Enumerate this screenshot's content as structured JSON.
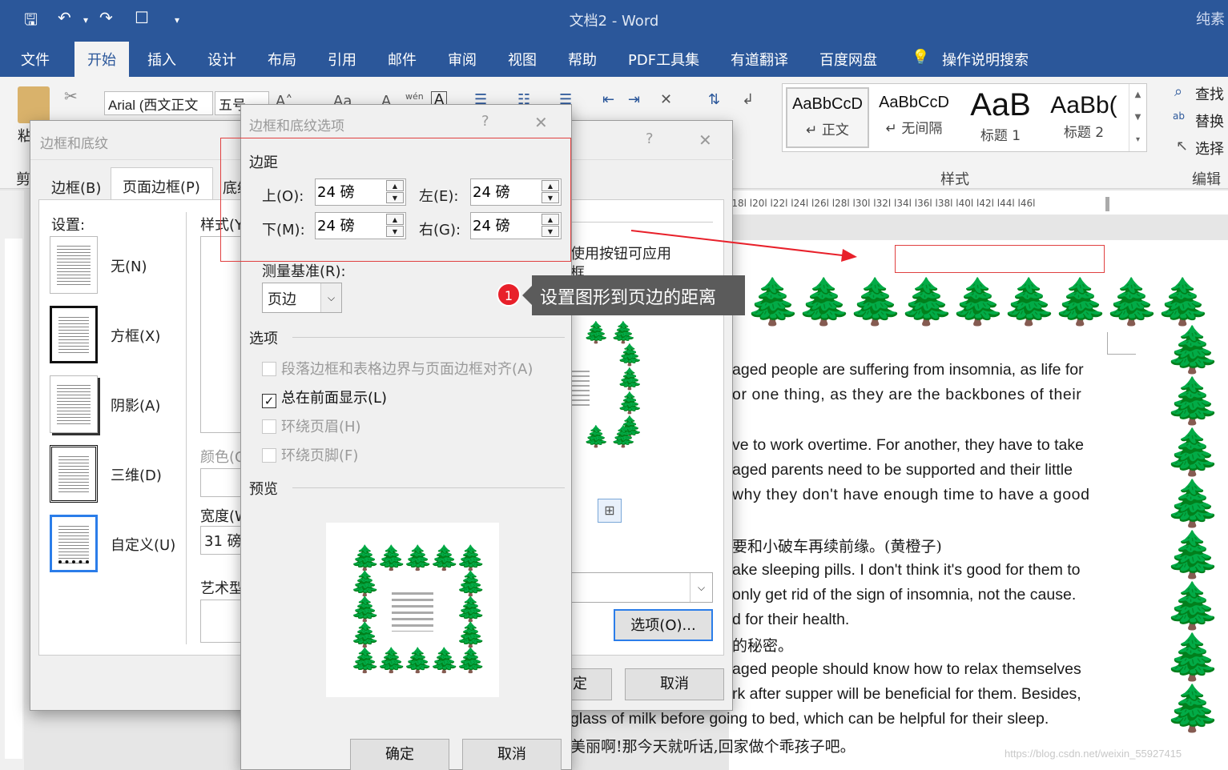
{
  "window": {
    "title": "文档2  -  Word",
    "right_note": "纯素"
  },
  "tabs": [
    "文件",
    "开始",
    "插入",
    "设计",
    "布局",
    "引用",
    "邮件",
    "审阅",
    "视图",
    "帮助",
    "PDF工具集",
    "有道翻译",
    "百度网盘",
    "操作说明搜索"
  ],
  "ribbon": {
    "font_name": "Arial (西文正文",
    "font_size": "五号",
    "paste_label": "粘",
    "cut_label": "剪",
    "pinyin_label": "wén",
    "styles": [
      {
        "sample": "AaBbCcD",
        "name": "↵ 正文"
      },
      {
        "sample": "AaBbCcD",
        "name": "↵ 无间隔"
      },
      {
        "sample": "AaB",
        "name": "标题 1"
      },
      {
        "sample": "AaBb(",
        "name": "标题 2"
      }
    ],
    "styles_group": "样式",
    "edit_group": "编辑",
    "find": "查找",
    "replace": "替换",
    "select": "选择"
  },
  "ruler": "l18l  l20l  l22l  l24l  l26l  l28l  l30l  l32l  l34l  l36l  l38l  l40l  l42l  l44l  l46l",
  "document": {
    "lines": [
      "aged people are suffering from insomnia, as life for",
      "or one thing, as they are the backbones of their",
      "ve to work overtime. For another, they have to take",
      "aged parents need to be supported and their little",
      "why they don't have enough time to have a good",
      "要和小破车再续前缘。(黄橙子)",
      "ake sleeping pills. I don't think it's good for them to",
      "only get rid of the sign of insomnia, not the cause.",
      "d for their health.",
      "的秘密。",
      "aged people should know how to relax themselves",
      "rk after supper will be beneficial for them. Besides,",
      "glass of milk before going to bed, which can be helpful for their sleep.",
      "美丽啊!那今天就听话,回家做个乖孩子吧。"
    ],
    "watermark": "https://blog.csdn.net/weixin_55927415"
  },
  "dialog_main": {
    "title": "边框和底纹",
    "help": "?",
    "close": "✕",
    "tabs": [
      "边框(B)",
      "页面边框(P)",
      "底纹"
    ],
    "settings_label": "设置:",
    "settings": [
      "无(N)",
      "方框(X)",
      "阴影(A)",
      "三维(D)",
      "自定义(U)"
    ],
    "style_label": "样式(Y",
    "color_label": "颜色(C",
    "width_label": "宽度(W",
    "width_value": "31 磅",
    "art_label": "艺术型",
    "preview_hint": "使用按钮可应用",
    "preview_hint2": "框",
    "options_button": "选项(O)...",
    "ok_button": "定",
    "cancel_button": "取消"
  },
  "dialog_options": {
    "title": "边框和底纹选项",
    "help": "?",
    "close": "✕",
    "margin_group": "边距",
    "top_label": "上(O):",
    "top_value": "24 磅",
    "bottom_label": "下(M):",
    "bottom_value": "24 磅",
    "left_label": "左(E):",
    "left_value": "24 磅",
    "right_label": "右(G):",
    "right_value": "24 磅",
    "measure_label": "测量基准(R):",
    "measure_value": "页边",
    "options_group": "选项",
    "checks": [
      {
        "label": "段落边框和表格边界与页面边框对齐(A)",
        "checked": false,
        "enabled": false
      },
      {
        "label": "总在前面显示(L)",
        "checked": true,
        "enabled": true
      },
      {
        "label": "环绕页眉(H)",
        "checked": false,
        "enabled": false
      },
      {
        "label": "环绕页脚(F)",
        "checked": false,
        "enabled": false
      }
    ],
    "preview_group": "预览",
    "ok": "确定",
    "cancel": "取消"
  },
  "annotation": {
    "number": "1",
    "text": "设置图形到页边的距离"
  },
  "colors": {
    "word_blue": "#2b579a",
    "tree_green": "#12861a",
    "annotation_red": "#e8202a",
    "callout_gray": "#5b5b5b"
  },
  "icons": {
    "tree": "🌲"
  }
}
